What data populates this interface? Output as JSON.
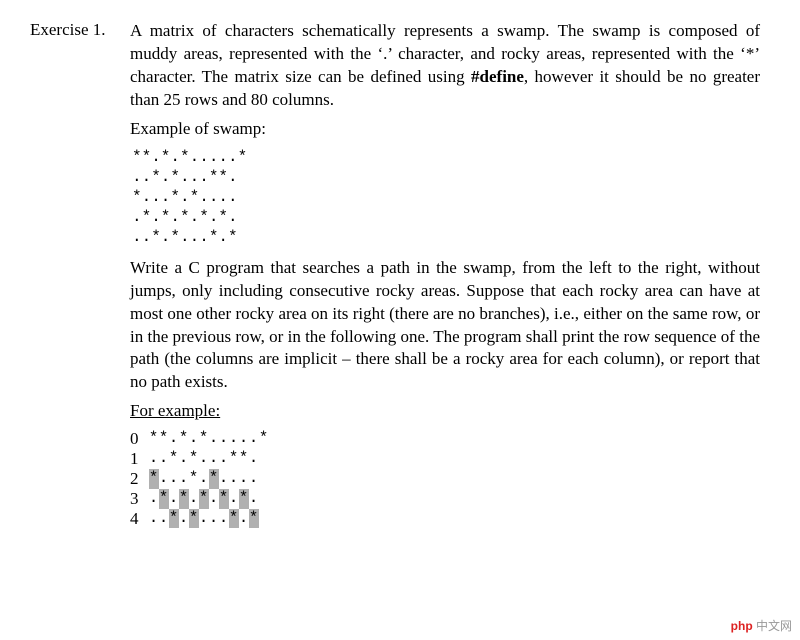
{
  "label": "Exercise 1.",
  "p1": {
    "a": "A matrix of characters schematically represents a swamp. The swamp is composed of muddy areas, represented with the ‘.’ character, and rocky areas, represented with the ‘*’ character. The matrix size can be defined using ",
    "b": "#define",
    "c": ", however it should be no greater than 25 rows and 80 columns."
  },
  "exampleHeading": "Example of swamp:",
  "swamp1": "**.*.*.....*\n..*.*...**.\n*...*.*....\n.*.*.*.*.*.\n..*.*...*.*",
  "p2": "Write a C program that searches a path in the swamp, from the left to the right, without jumps, only including consecutive rocky areas. Suppose that each rocky area can have at most one other rocky area on its right (there are no branches), i.e., either on the same row, or in the previous row, or in the following one. The program shall print the row sequence of the path (the columns are implicit – there shall be a rocky area for each column), or report that no path exists.",
  "forExample": "For example:",
  "rownums": "0\n1\n2\n3\n4",
  "grid": {
    "rows": [
      "**.*.*.....*",
      "..*.*...**.",
      "*...*.*....",
      ".*.*.*.*.*.",
      "..*.*...*.*"
    ],
    "highlight": [
      [
        2,
        0
      ],
      [
        3,
        1
      ],
      [
        4,
        2
      ],
      [
        3,
        3
      ],
      [
        4,
        4
      ],
      [
        3,
        5
      ],
      [
        2,
        6
      ],
      [
        3,
        7
      ],
      [
        4,
        8
      ],
      [
        3,
        9
      ],
      [
        4,
        10
      ]
    ]
  },
  "watermark": {
    "red": "php",
    "rest": " 中文网"
  }
}
